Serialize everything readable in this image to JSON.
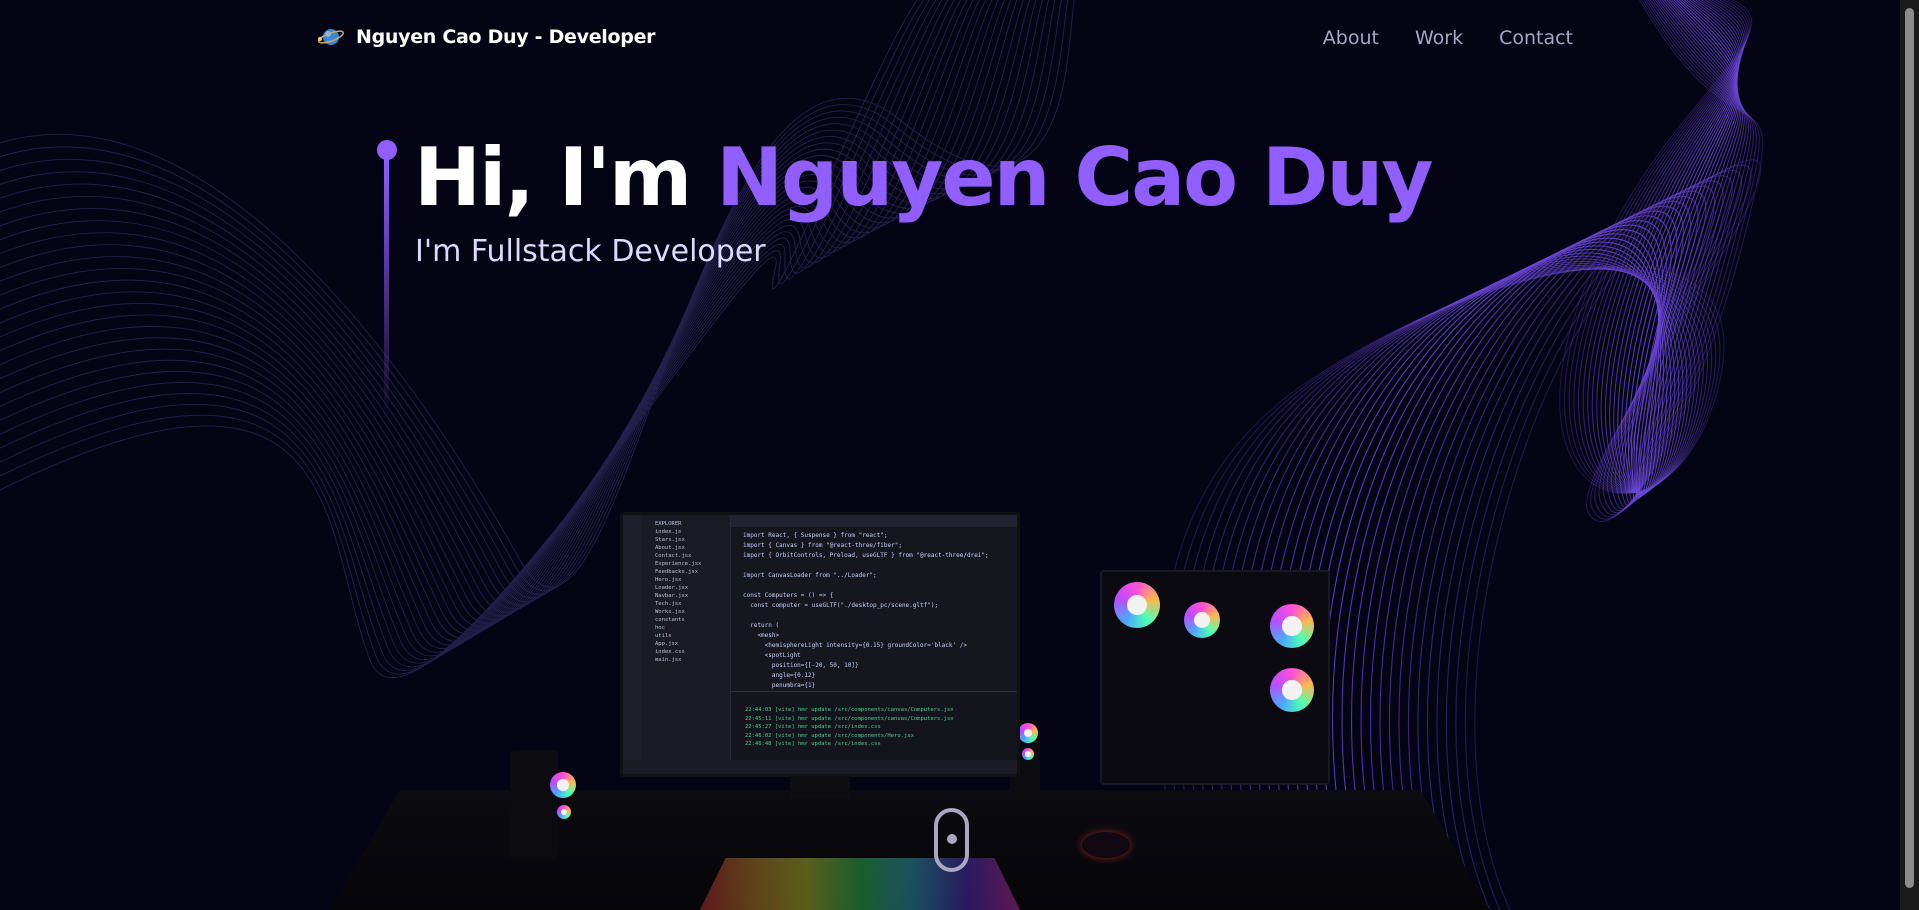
{
  "nav": {
    "brand": "Nguyen Cao Duy - Developer",
    "links": [
      "About",
      "Work",
      "Contact"
    ]
  },
  "hero": {
    "greeting": "Hi, I'm ",
    "name": "Nguyen Cao Duy",
    "subtitle": "I'm Fullstack Developer"
  },
  "colors": {
    "background": "#050414",
    "accent": "#915eff",
    "nav_link": "#aaa6c3",
    "subtitle": "#dfd9ff"
  },
  "icons": {
    "logo": "planet-logo-icon",
    "scroll": "scroll-mouse-icon"
  }
}
